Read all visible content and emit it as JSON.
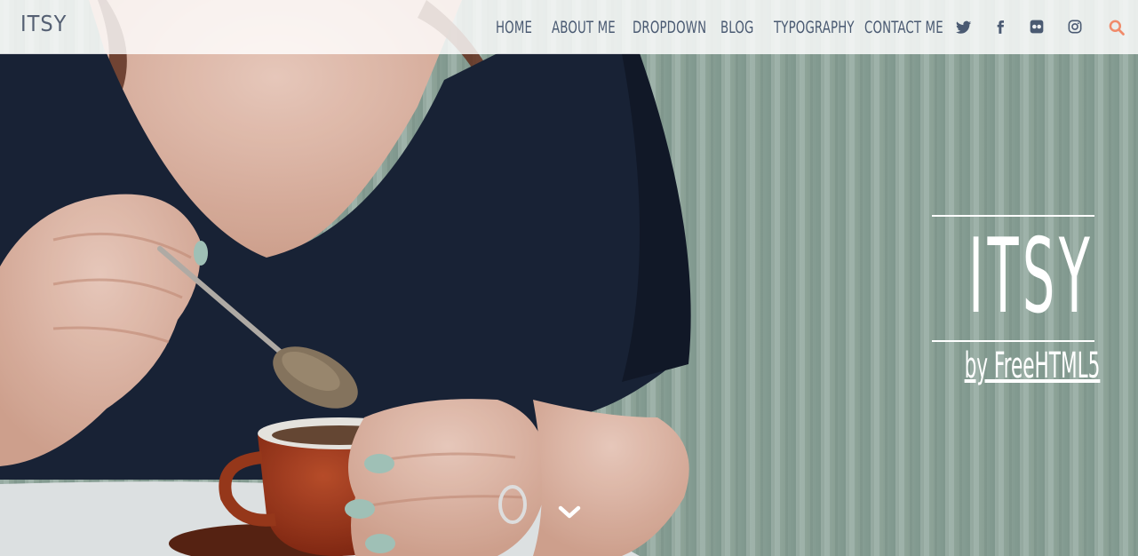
{
  "site": {
    "brand": "ITSY"
  },
  "nav": {
    "items": [
      {
        "label": "HOME"
      },
      {
        "label": "ABOUT ME"
      },
      {
        "label": "DROPDOWN"
      },
      {
        "label": "BLOG"
      },
      {
        "label": "TYPOGRAPHY"
      },
      {
        "label": "CONTACT ME"
      }
    ],
    "social": [
      "twitter-icon",
      "facebook-icon",
      "flickr-icon",
      "instagram-icon"
    ],
    "search_icon": "search-icon"
  },
  "hero": {
    "title": "ITSY",
    "subtitle": "by FreeHTML5",
    "scroll_icon": "chevron-down-icon"
  },
  "colors": {
    "nav_text": "#4a5a72",
    "accent": "#f08a6a",
    "hero_text": "#ffffff"
  }
}
